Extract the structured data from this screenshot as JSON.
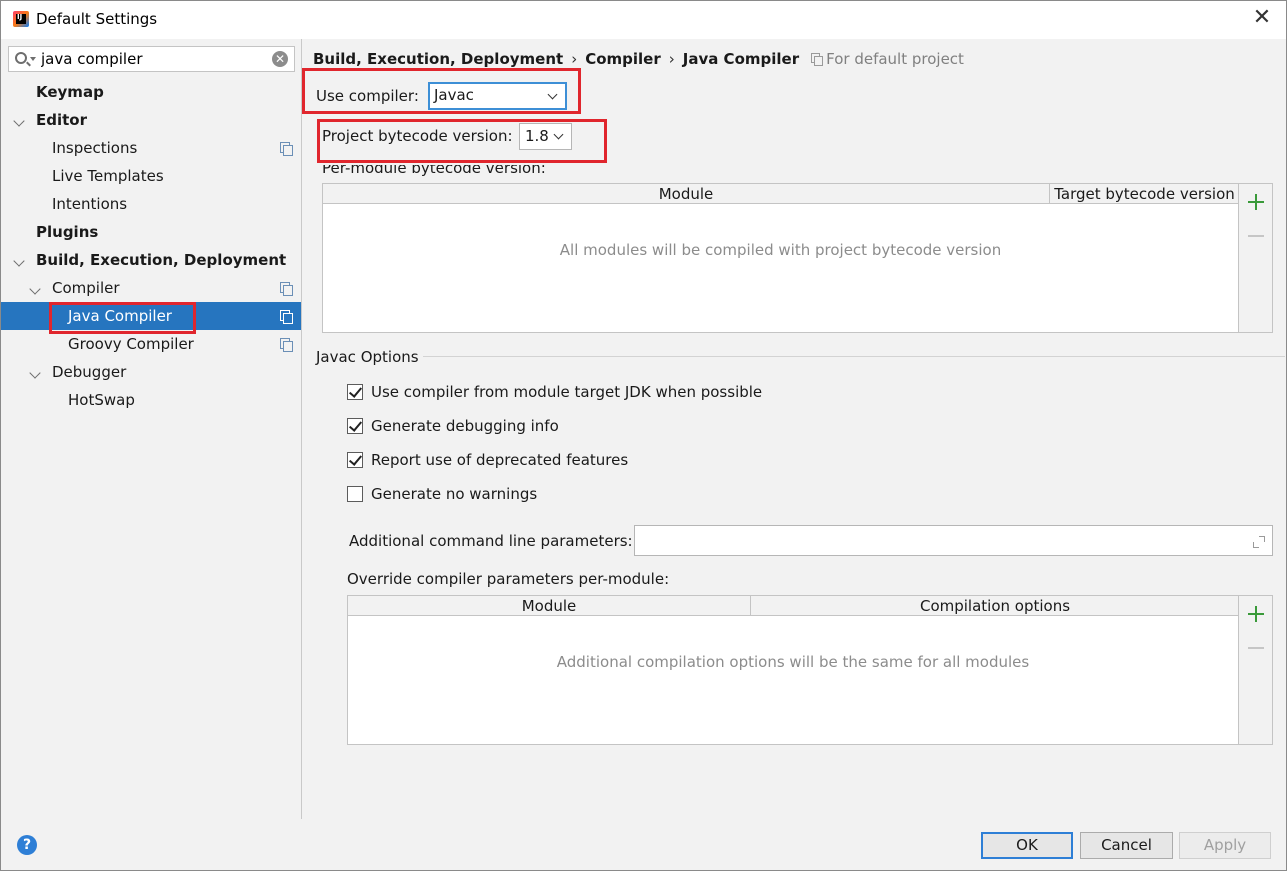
{
  "window": {
    "title": "Default Settings",
    "close_glyph": "✕"
  },
  "sidebar": {
    "search": {
      "value": "java compiler",
      "placeholder": ""
    },
    "items": [
      {
        "label": "Keymap",
        "bold": true,
        "expanded": null,
        "level": 0,
        "has_scope_icon": false,
        "selected": false
      },
      {
        "label": "Editor",
        "bold": true,
        "expanded": true,
        "level": 0,
        "has_scope_icon": false,
        "selected": false
      },
      {
        "label": "Inspections",
        "bold": false,
        "expanded": null,
        "level": 1,
        "has_scope_icon": true,
        "selected": false
      },
      {
        "label": "Live Templates",
        "bold": false,
        "expanded": null,
        "level": 1,
        "has_scope_icon": false,
        "selected": false
      },
      {
        "label": "Intentions",
        "bold": false,
        "expanded": null,
        "level": 1,
        "has_scope_icon": false,
        "selected": false
      },
      {
        "label": "Plugins",
        "bold": true,
        "expanded": null,
        "level": 0,
        "has_scope_icon": false,
        "selected": false
      },
      {
        "label": "Build, Execution, Deployment",
        "bold": true,
        "expanded": true,
        "level": 0,
        "has_scope_icon": false,
        "selected": false
      },
      {
        "label": "Compiler",
        "bold": false,
        "expanded": true,
        "level": 1,
        "has_scope_icon": true,
        "selected": false
      },
      {
        "label": "Java Compiler",
        "bold": false,
        "expanded": null,
        "level": 2,
        "has_scope_icon": true,
        "selected": true
      },
      {
        "label": "Groovy Compiler",
        "bold": false,
        "expanded": null,
        "level": 2,
        "has_scope_icon": true,
        "selected": false
      },
      {
        "label": "Debugger",
        "bold": false,
        "expanded": true,
        "level": 1,
        "has_scope_icon": false,
        "selected": false
      },
      {
        "label": "HotSwap",
        "bold": false,
        "expanded": null,
        "level": 2,
        "has_scope_icon": false,
        "selected": false
      }
    ]
  },
  "breadcrumb": {
    "parts": [
      "Build, Execution, Deployment",
      "Compiler",
      "Java Compiler"
    ],
    "separator": "›",
    "scope": "For default project"
  },
  "compiler": {
    "use_compiler_label": "Use compiler:",
    "use_compiler_value": "Javac",
    "bytecode_label": "Project bytecode version:",
    "bytecode_value": "1.8",
    "per_module_label": "Per-module bytecode version:",
    "per_module_table": {
      "columns": [
        "Module",
        "Target bytecode version"
      ],
      "empty_text": "All modules will be compiled with project bytecode version"
    }
  },
  "javac_options": {
    "group_title": "Javac Options",
    "checkboxes": [
      {
        "label": "Use compiler from module target JDK when possible",
        "checked": true
      },
      {
        "label": "Generate debugging info",
        "checked": true
      },
      {
        "label": "Report use of deprecated features",
        "checked": true
      },
      {
        "label": "Generate no warnings",
        "checked": false
      }
    ],
    "additional_params_label": "Additional command line parameters:",
    "additional_params_value": "",
    "override_label": "Override compiler parameters per-module:",
    "override_table": {
      "columns": [
        "Module",
        "Compilation options"
      ],
      "empty_text": "Additional compilation options will be the same for all modules"
    }
  },
  "buttons": {
    "ok": "OK",
    "cancel": "Cancel",
    "apply": "Apply",
    "help": "?"
  },
  "colors": {
    "selection": "#2675bf",
    "highlight_box": "#e0262d",
    "add_icon": "#3a9a3a",
    "focus": "#2e7fd6"
  },
  "icons": {
    "app": "intellij-idea-icon",
    "search": "search-icon",
    "clear": "clear-icon",
    "scope": "copy-scope-icon",
    "add": "plus-icon",
    "remove": "minus-icon",
    "expand": "expand-icon",
    "help": "help-icon"
  }
}
